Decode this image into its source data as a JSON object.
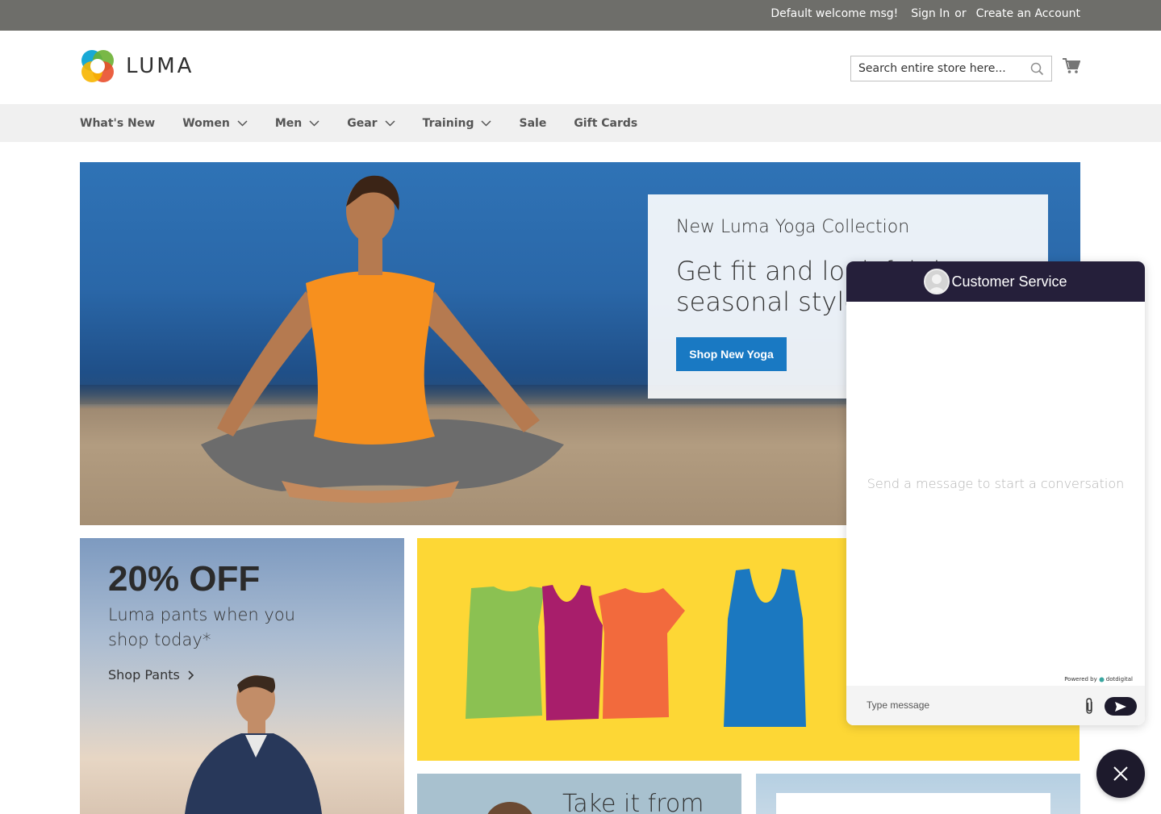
{
  "top_panel": {
    "welcome": "Default welcome msg!",
    "sign_in": "Sign In",
    "or": "or",
    "create_account": "Create an Account"
  },
  "header": {
    "logo_text": "LUMA",
    "search_placeholder": "Search entire store here...",
    "search_icon": "search-icon",
    "cart_icon": "cart-icon"
  },
  "nav": {
    "items": [
      {
        "label": "What's New",
        "has_submenu": false
      },
      {
        "label": "Women",
        "has_submenu": true
      },
      {
        "label": "Men",
        "has_submenu": true
      },
      {
        "label": "Gear",
        "has_submenu": true
      },
      {
        "label": "Training",
        "has_submenu": true
      },
      {
        "label": "Sale",
        "has_submenu": false
      },
      {
        "label": "Gift Cards",
        "has_submenu": false
      }
    ]
  },
  "hero": {
    "subtitle": "New Luma Yoga Collection",
    "headline": "Get fit and look fab in new seasonal styles",
    "button": "Shop New Yoga"
  },
  "pants_promo": {
    "discount": "20% OFF",
    "description": "Luma pants when you shop today*",
    "link": "Shop Pants"
  },
  "promo_a": {
    "text": "Take it from"
  },
  "chat": {
    "title": "Customer Service",
    "empty_state": "Send a message to start a conversation",
    "powered_by": "Powered by",
    "powered_brand": "dotdigital",
    "input_placeholder": "Type message"
  },
  "colors": {
    "top_bar": "#6e6e6a",
    "nav_bg": "#f0f0f0",
    "primary_button": "#1979c3",
    "chat_header": "#251f3a",
    "tees_bg": "#fdd735"
  }
}
